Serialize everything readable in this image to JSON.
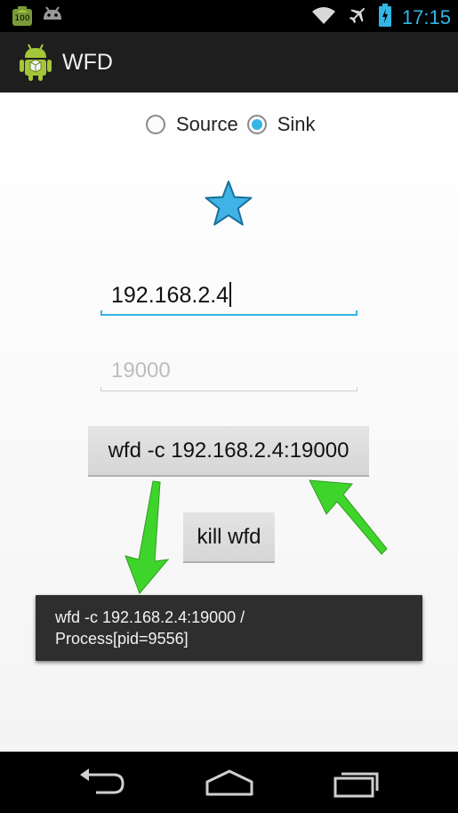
{
  "status_bar": {
    "time": "17:15",
    "battery_notification_text": "100",
    "left_icons": [
      "battery-100-notification-icon",
      "android-debug-icon"
    ],
    "right_icons": [
      "wifi-icon",
      "airplane-icon",
      "battery-icon"
    ]
  },
  "action_bar": {
    "icon": "android-app-icon",
    "title": "WFD"
  },
  "mode": {
    "options": [
      {
        "label": "Source",
        "checked": false
      },
      {
        "label": "Sink",
        "checked": true
      }
    ]
  },
  "star_icon": {
    "name": "star-icon",
    "color": "#3fb3e6"
  },
  "ip_field": {
    "value": "192.168.2.4"
  },
  "port_field": {
    "placeholder": "19000"
  },
  "buttons": {
    "wfd_label": "wfd -c 192.168.2.4:19000",
    "kill_label": "kill wfd"
  },
  "toast": {
    "line1": "wfd -c 192.168.2.4:19000 /",
    "line2": "Process[pid=9556]"
  },
  "annotation_color": "#3fd42b",
  "colors": {
    "accent": "#33b5e5",
    "action_bar": "#1e1e1e",
    "toast_bg": "#2e2e2e"
  },
  "nav_bar": {
    "icons": [
      "back-icon",
      "home-icon",
      "recents-icon"
    ]
  }
}
